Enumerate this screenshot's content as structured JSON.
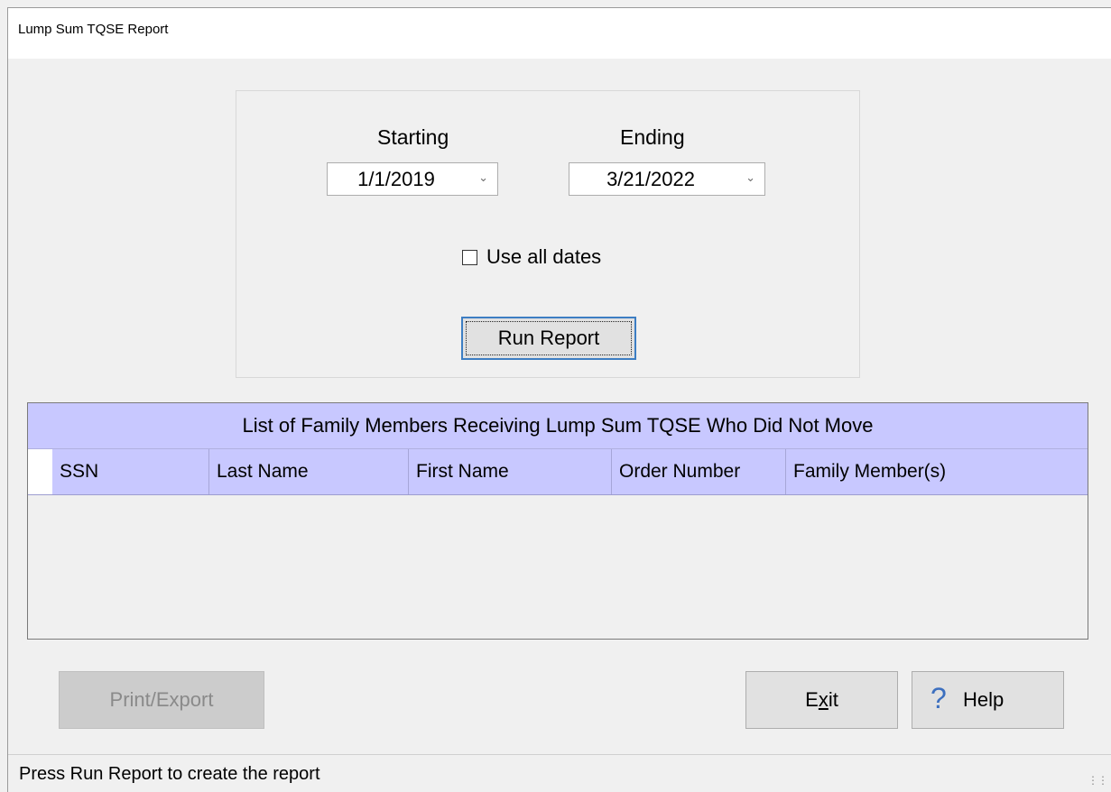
{
  "window": {
    "title": "Lump Sum TQSE Report"
  },
  "date_range": {
    "starting_label": "Starting",
    "ending_label": "Ending",
    "starting_value": "1/1/2019",
    "ending_value": "3/21/2022",
    "use_all_dates_label": "Use all dates",
    "use_all_dates_checked": false,
    "run_report_label": "Run Report"
  },
  "grid": {
    "caption": "List of Family Members Receiving Lump Sum TQSE Who Did Not Move",
    "columns": [
      "SSN",
      "Last Name",
      "First Name",
      "Order Number",
      "Family Member(s)"
    ],
    "rows": []
  },
  "buttons": {
    "print_export": "Print/Export",
    "exit": "Exit",
    "exit_mnemonic_prefix": "E",
    "exit_mnemonic": "x",
    "exit_mnemonic_suffix": "it",
    "help": "Help"
  },
  "status_bar": {
    "text": "Press Run Report to create the report"
  },
  "colors": {
    "grid_header": "#c8c8ff",
    "focus_border": "#3d7ec3",
    "help_icon": "#3c6fbf"
  },
  "icons": {
    "dropdown": "chevron-down-icon",
    "help": "question-mark-icon",
    "resize": "resize-grip-icon"
  }
}
